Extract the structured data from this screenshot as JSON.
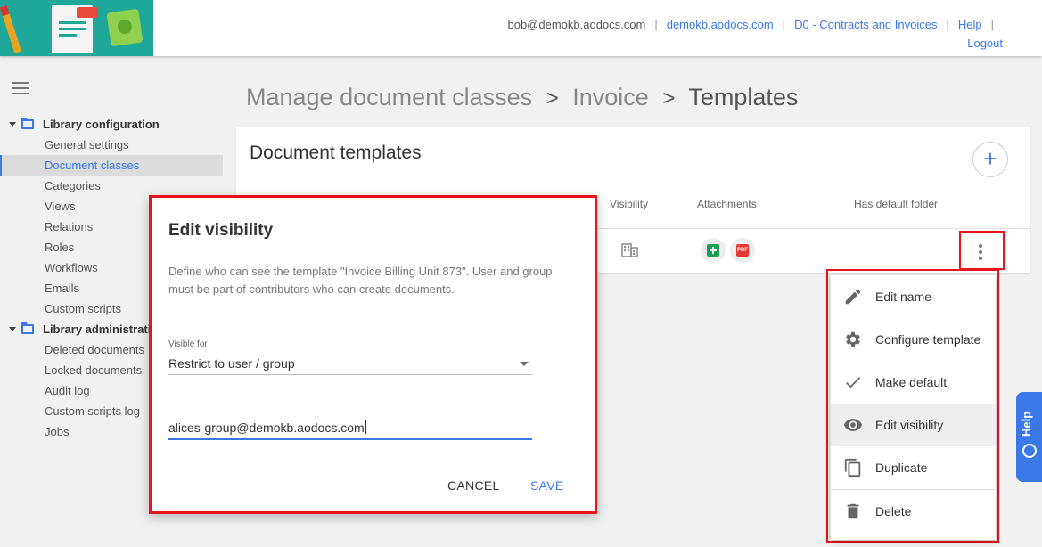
{
  "header": {
    "user_email": "bob@demokb.aodocs.com",
    "domain_link": "demokb.aodocs.com",
    "library_link": "D0 - Contracts and Invoices",
    "help_link": "Help",
    "logout_link": "Logout"
  },
  "sidebar": {
    "sections": [
      {
        "label": "Library configuration",
        "items": [
          "General settings",
          "Document classes",
          "Categories",
          "Views",
          "Relations",
          "Roles",
          "Workflows",
          "Emails",
          "Custom scripts"
        ]
      },
      {
        "label": "Library administrati",
        "items": [
          "Deleted documents",
          "Locked documents",
          "Audit log",
          "Custom scripts log",
          "Jobs"
        ]
      }
    ],
    "active_item": "Document classes"
  },
  "breadcrumb": {
    "part1": "Manage document classes",
    "part2": "Invoice",
    "part3": "Templates",
    "separator": ">"
  },
  "card": {
    "title": "Document templates",
    "add_button": "+",
    "columns": {
      "visibility": "Visibility",
      "attachments": "Attachments",
      "default_folder": "Has default folder"
    },
    "attachments_icons": [
      "sheets-icon",
      "pdf-icon"
    ],
    "pdf_label": "PDF"
  },
  "menu": {
    "items": [
      {
        "label": "Edit name",
        "icon": "pencil-icon"
      },
      {
        "label": "Configure template",
        "icon": "gear-icon"
      },
      {
        "label": "Make default",
        "icon": "check-icon"
      },
      {
        "label": "Edit visibility",
        "icon": "eye-icon"
      },
      {
        "label": "Duplicate",
        "icon": "copy-icon"
      },
      {
        "label": "Delete",
        "icon": "trash-icon"
      }
    ]
  },
  "dialog": {
    "title": "Edit visibility",
    "description": "Define who can see the template \"Invoice Billing Unit 873\". User and group must be part of contributors who can create documents.",
    "visible_for_label": "Visible for",
    "visible_for_value": "Restrict to user / group",
    "group_value": "alices-group@demokb.aodocs.com",
    "cancel": "CANCEL",
    "save": "SAVE"
  },
  "help_tab": {
    "label": "Help"
  },
  "colors": {
    "accent": "#3b78e7",
    "highlight": "#e8141b",
    "logo_bg": "#1fa89a"
  }
}
